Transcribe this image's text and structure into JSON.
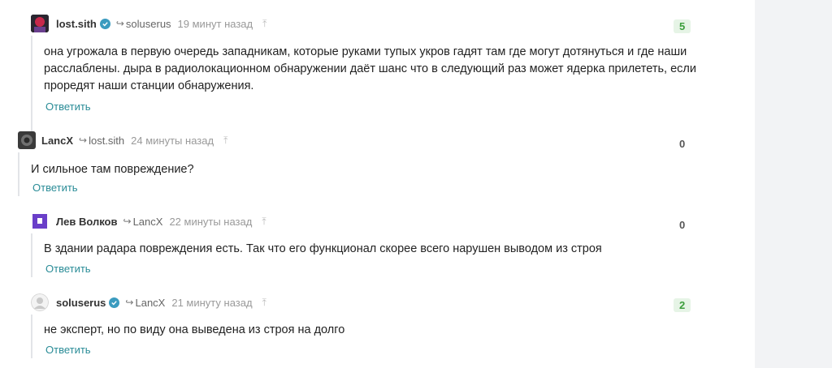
{
  "comments": [
    {
      "author": "lost.sith",
      "verified": true,
      "reply_to": "soluserus",
      "time": "19 минут назад",
      "score": "5",
      "text": "она угрожала в первую очередь западникам, которые руками тупых укров гадят там где могут дотянуться и где наши расслаблены. дыра в радиолокационном обнаружении даёт шанс что в следующий раз может ядерка прилететь, если проредят наши станции обнаружения.",
      "reply_label": "Ответить"
    },
    {
      "author": "LancX",
      "verified": false,
      "reply_to": "lost.sith",
      "time": "24 минуты назад",
      "score": "0",
      "text": "И сильное там повреждение?",
      "reply_label": "Ответить"
    },
    {
      "author": "Лев Волков",
      "verified": false,
      "reply_to": "LancX",
      "time": "22 минуты назад",
      "score": "0",
      "text": "В здании радара повреждения есть. Так что его функционал скорее всего нарушен выводом из строя",
      "reply_label": "Ответить"
    },
    {
      "author": "soluserus",
      "verified": true,
      "reply_to": "LancX",
      "time": "21 минуту назад",
      "score": "2",
      "text": "не эксперт, но по виду она выведена из строя на долго",
      "reply_label": "Ответить"
    }
  ]
}
